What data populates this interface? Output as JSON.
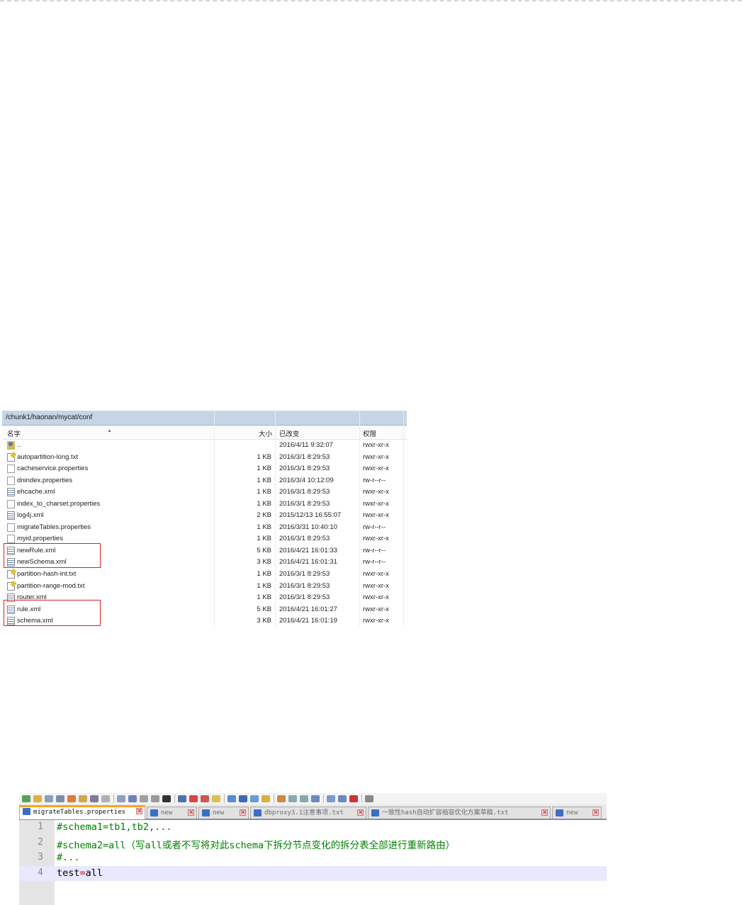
{
  "file_browser": {
    "path": "/chunk1/haonan/mycat/conf",
    "columns": {
      "name": "名字",
      "size": "大小",
      "modified": "已改变",
      "permissions": "权限"
    },
    "files": [
      {
        "icon": "parent-folder-icon",
        "name": "..",
        "size": "",
        "modified": "2016/4/11 9:32:07",
        "permissions": "rwxr-xr-x"
      },
      {
        "icon": "text-file-icon",
        "name": "autopartition-long.txt",
        "size": "1 KB",
        "modified": "2016/3/1 8:29:53",
        "permissions": "rwxr-xr-x"
      },
      {
        "icon": "file-icon",
        "name": "cacheservice.properties",
        "size": "1 KB",
        "modified": "2016/3/1 8:29:53",
        "permissions": "rwxr-xr-x"
      },
      {
        "icon": "file-icon",
        "name": "dnindex.properties",
        "size": "1 KB",
        "modified": "2016/3/4 10:12:09",
        "permissions": "rw-r--r--"
      },
      {
        "icon": "xml-file-icon",
        "name": "ehcache.xml",
        "size": "1 KB",
        "modified": "2016/3/1 8:29:53",
        "permissions": "rwxr-xr-x"
      },
      {
        "icon": "file-icon",
        "name": "index_to_charset.properties",
        "size": "1 KB",
        "modified": "2016/3/1 8:29:53",
        "permissions": "rwxr-xr-x"
      },
      {
        "icon": "xml-file-icon",
        "name": "log4j.xml",
        "size": "2 KB",
        "modified": "2015/12/13 16:55:07",
        "permissions": "rwxr-xr-x"
      },
      {
        "icon": "file-icon",
        "name": "migrateTables.properties",
        "size": "1 KB",
        "modified": "2016/3/31 10:40:10",
        "permissions": "rw-r--r--"
      },
      {
        "icon": "file-icon",
        "name": "myid.properties",
        "size": "1 KB",
        "modified": "2016/3/1 8:29:53",
        "permissions": "rwxr-xr-x"
      },
      {
        "icon": "xml-file-icon",
        "name": "newRule.xml",
        "size": "5 KB",
        "modified": "2016/4/21 16:01:33",
        "permissions": "rw-r--r--"
      },
      {
        "icon": "xml-file-icon",
        "name": "newSchema.xml",
        "size": "3 KB",
        "modified": "2016/4/21 16:01:31",
        "permissions": "rw-r--r--"
      },
      {
        "icon": "text-file-icon",
        "name": "partition-hash-int.txt",
        "size": "1 KB",
        "modified": "2016/3/1 8:29:53",
        "permissions": "rwxr-xr-x"
      },
      {
        "icon": "text-file-icon",
        "name": "partition-range-mod.txt",
        "size": "1 KB",
        "modified": "2016/3/1 8:29:53",
        "permissions": "rwxr-xr-x"
      },
      {
        "icon": "xml-file-icon",
        "name": "router.xml",
        "size": "1 KB",
        "modified": "2016/3/1 8:29:53",
        "permissions": "rwxr-xr-x"
      },
      {
        "icon": "xml-file-icon",
        "name": "rule.xml",
        "size": "5 KB",
        "modified": "2016/4/21 16:01:27",
        "permissions": "rwxr-xr-x"
      },
      {
        "icon": "xml-file-icon",
        "name": "schema.xml",
        "size": "3 KB",
        "modified": "2016/4/21 16:01:19",
        "permissions": "rwxr-xr-x"
      }
    ]
  },
  "editor": {
    "tabs": [
      {
        "label": "migrateTables.properties",
        "active": true
      },
      {
        "label": "new ",
        "active": false
      },
      {
        "label": "new ",
        "active": false
      },
      {
        "label": "dbproxy3.1注意事项.txt",
        "active": false
      },
      {
        "label": "一致性hash自动扩容缩容优化方案草稿.txt",
        "active": false
      },
      {
        "label": "new ",
        "active": false
      }
    ],
    "tab_close_glyph": "✕",
    "lines": [
      {
        "number": "1",
        "text": "#schema1=tb1,tb2,..."
      },
      {
        "number": "2",
        "text": "#schema2=all（写all或者不写将对此schema下拆分节点变化的拆分表全部进行重新路由）"
      },
      {
        "number": "3",
        "text": "#..."
      },
      {
        "number": "4",
        "key": "test",
        "op": "=",
        "value": "all"
      }
    ]
  },
  "colors": {
    "comment": "#008000",
    "operator": "#e00000",
    "current_line": "#e8e8ff",
    "highlight_box": "#e02020",
    "active_tab_accent": "#f5a623"
  }
}
